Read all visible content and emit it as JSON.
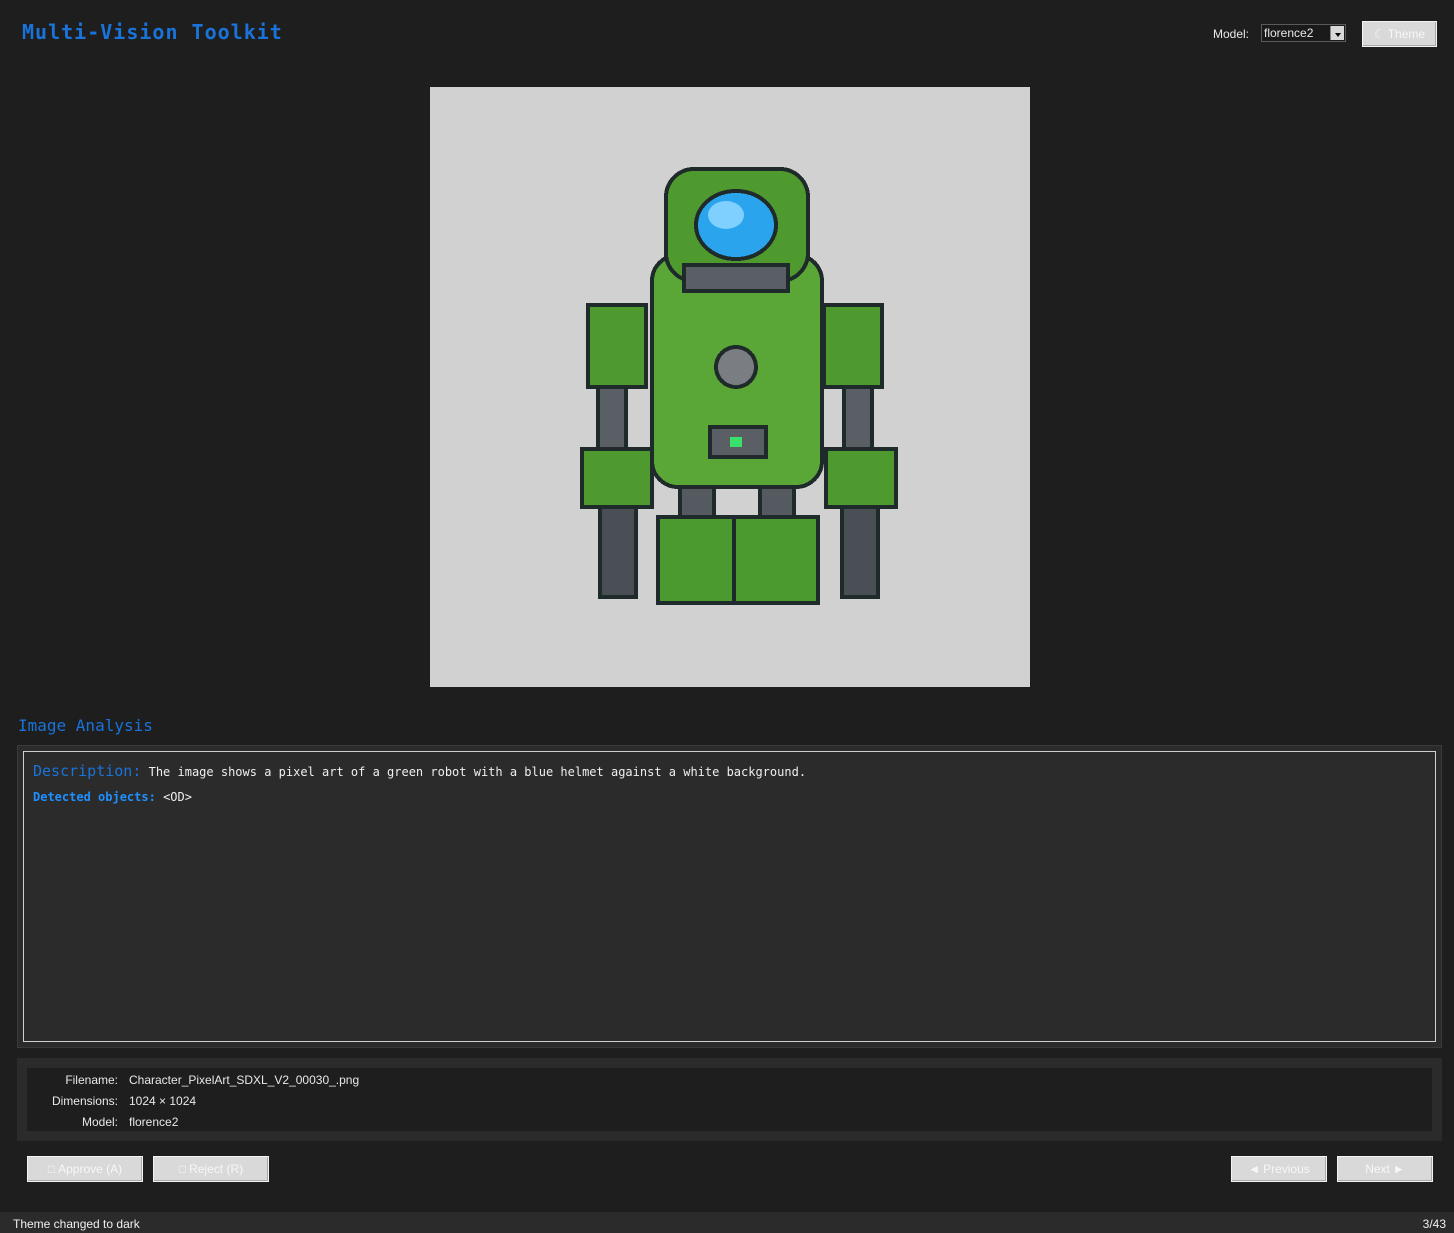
{
  "header": {
    "title": "Multi-Vision Toolkit",
    "model_label": "Model:",
    "model_value": "florence2",
    "theme_button": "Theme",
    "theme_icon": "☾"
  },
  "image": {
    "alt": "pixel art green robot with blue helmet"
  },
  "analysis": {
    "section_title": "Image Analysis",
    "description_label": "Description:",
    "description_text": "The image shows a pixel art of a green robot with a blue helmet against a white background.",
    "objects_label": "Detected objects:",
    "objects_text": "<OD>"
  },
  "info": {
    "filename_label": "Filename:",
    "filename_value": "Character_PixelArt_SDXL_V2_00030_.png",
    "dimensions_label": "Dimensions:",
    "dimensions_value": "1024 × 1024",
    "model_label": "Model:",
    "model_value": "florence2"
  },
  "actions": {
    "approve": "Approve (A)",
    "approve_icon": "□",
    "reject": "Reject (R)",
    "reject_icon": "□",
    "previous": "Previous",
    "previous_icon": "◄",
    "next": "Next",
    "next_icon": "►"
  },
  "status": {
    "message": "Theme changed to dark",
    "counter": "3/43"
  },
  "colors": {
    "accent": "#1a73d9",
    "background": "#1e1e1e",
    "panel": "#2b2b2b"
  }
}
